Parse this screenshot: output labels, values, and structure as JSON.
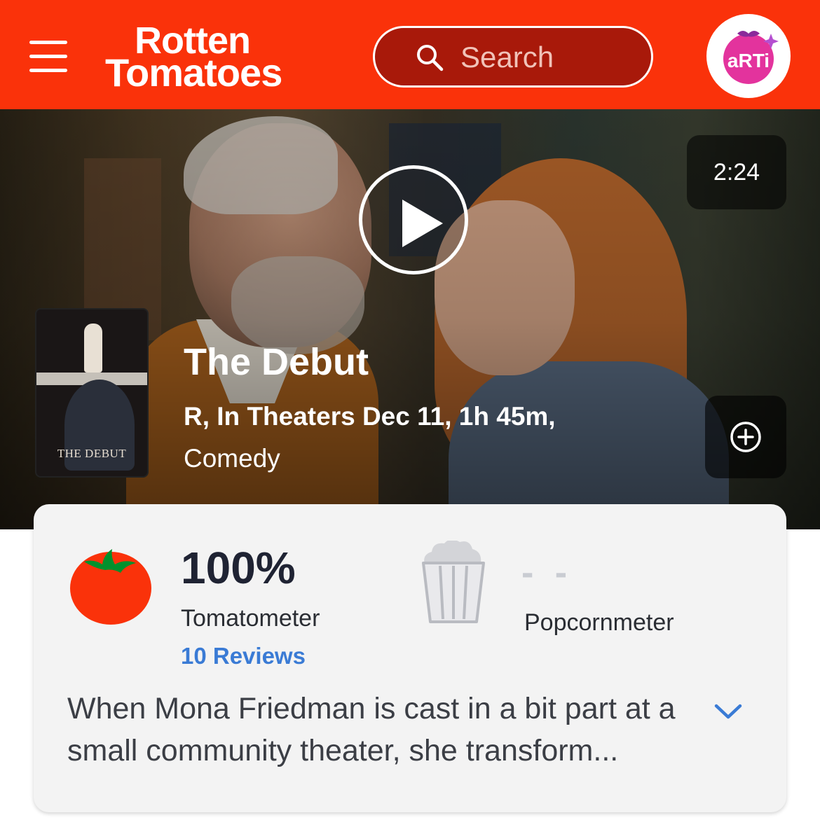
{
  "header": {
    "logo_line1": "Rotten",
    "logo_line2": "Tomatoes",
    "search_placeholder": "Search",
    "avatar_label": "aRTi",
    "brand_color": "#fa320a"
  },
  "hero": {
    "duration": "2:24",
    "poster_title": "THE DEBUT",
    "title": "The Debut",
    "meta": "R, In Theaters Dec 11, 1h 45m,",
    "genre": "Comedy",
    "add_icon": "plus-circle-icon",
    "play_icon": "play-icon"
  },
  "scores": {
    "tomatometer_value": "100%",
    "tomatometer_label": "Tomatometer",
    "reviews_link": "10 Reviews",
    "popcornmeter_value": "- -",
    "popcornmeter_label": "Popcornmeter",
    "link_color": "#3a7bd5"
  },
  "synopsis": {
    "text": "When Mona Friedman is cast in a bit part at a small community theater, she transform...",
    "expand_icon": "chevron-down-icon"
  }
}
